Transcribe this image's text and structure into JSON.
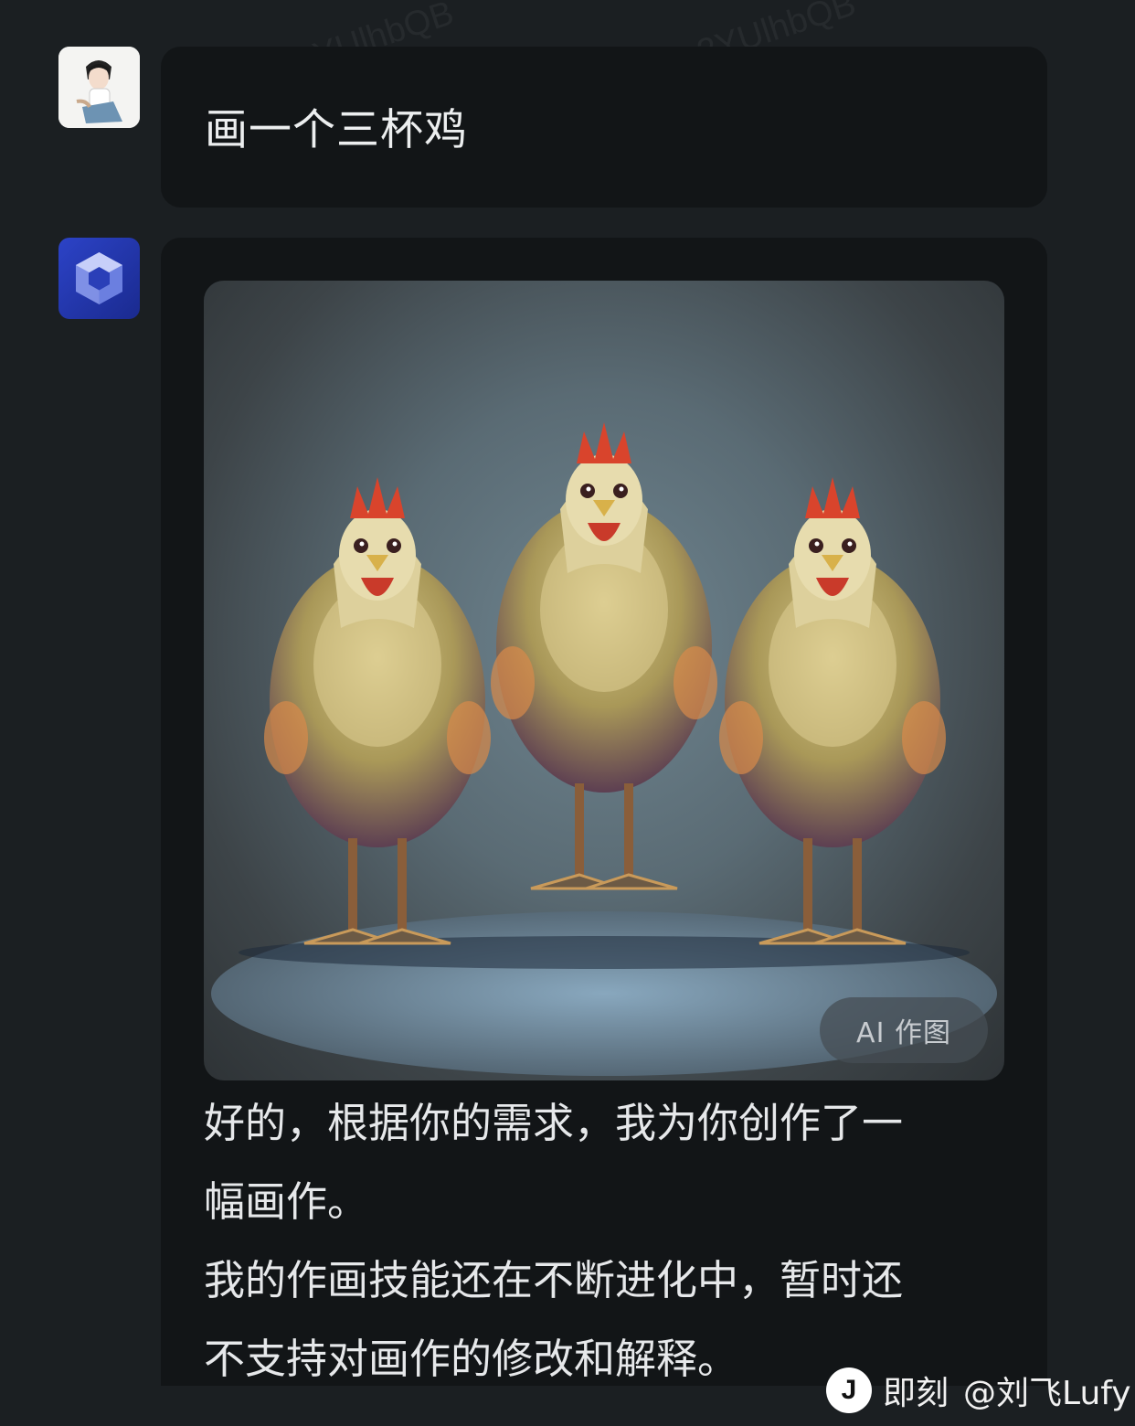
{
  "conversation": {
    "user_message": "画一个三杯鸡",
    "bot_image_badge": "AI 作图",
    "bot_reply_lines": [
      "好的，根据你的需求，我为你创作了一",
      "幅画作。",
      "我的作画技能还在不断进化中，暂时还",
      "不支持对画作的修改和解释。"
    ]
  },
  "watermark_text": "2YUlhbQB",
  "footer": {
    "logo_glyph": "J",
    "app_name": "即刻",
    "username": "@刘飞Lufy"
  },
  "icons": {
    "user_avatar": "anime-character-avatar",
    "bot_avatar": "cube-logo-icon"
  },
  "colors": {
    "background": "#1b1f22",
    "bubble": "#121517",
    "bot_avatar": "#2c43c7"
  }
}
